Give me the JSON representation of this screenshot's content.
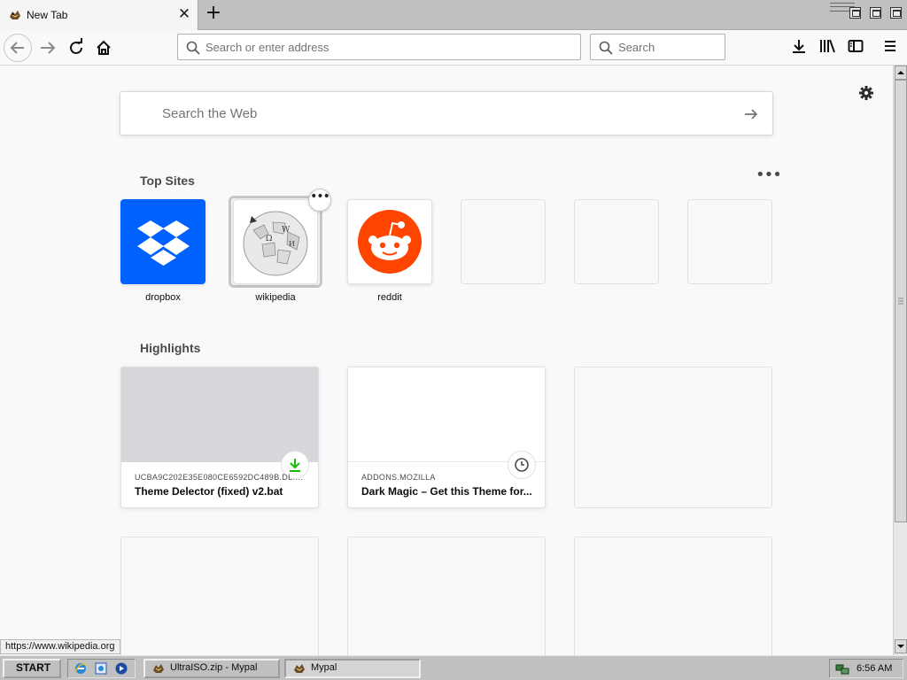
{
  "tab": {
    "title": "New Tab"
  },
  "nav": {
    "url_placeholder": "Search or enter address",
    "search_placeholder": "Search"
  },
  "newtab": {
    "web_search_placeholder": "Search the Web",
    "top_sites_title": "Top Sites",
    "top_sites": [
      {
        "label": "dropbox",
        "color": "#0061fe"
      },
      {
        "label": "wikipedia",
        "color": "#ffffff"
      },
      {
        "label": "reddit",
        "color": "#ff4500"
      }
    ],
    "highlights_title": "Highlights",
    "highlights": [
      {
        "host": "UCBA9C202E35E080CE6592DC489B.DL.DR...",
        "title": "Theme Delector (fixed) v2.bat",
        "type": "download",
        "thumb_color": "#d7d7db"
      },
      {
        "host": "ADDONS.MOZILLA",
        "title": "Dark Magic – Get this Theme for...",
        "type": "history",
        "thumb_color": "#ffffff"
      }
    ]
  },
  "status": {
    "link": "https://www.wikipedia.org"
  },
  "taskbar": {
    "start_label": "START",
    "tasks": [
      {
        "label": "UltraISO.zip - Mypal"
      },
      {
        "label": "Mypal"
      }
    ],
    "clock": "6:56 AM"
  }
}
